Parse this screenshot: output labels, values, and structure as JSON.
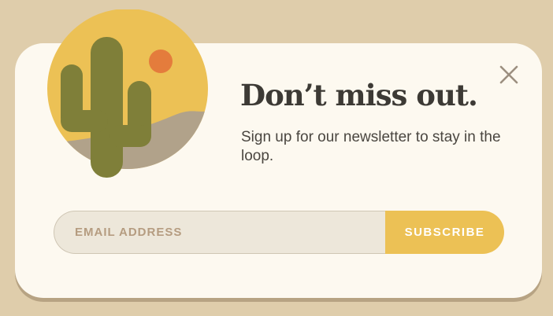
{
  "popup": {
    "headline": "Don’t miss out.",
    "subtitle": "Sign up for our newsletter to stay in the loop.",
    "email_placeholder": "EMAIL ADDRESS",
    "subscribe_label": "SUBSCRIBE",
    "close_icon": "close-icon",
    "illustration_icon": "desert-cactus-illustration"
  },
  "colors": {
    "background": "#dfcdab",
    "card": "#fdf9f0",
    "accent": "#ecc155",
    "sun": "#e47c3c",
    "cactus": "#7f7f39",
    "dune": "#b1a28a",
    "text": "#3d3a35"
  }
}
